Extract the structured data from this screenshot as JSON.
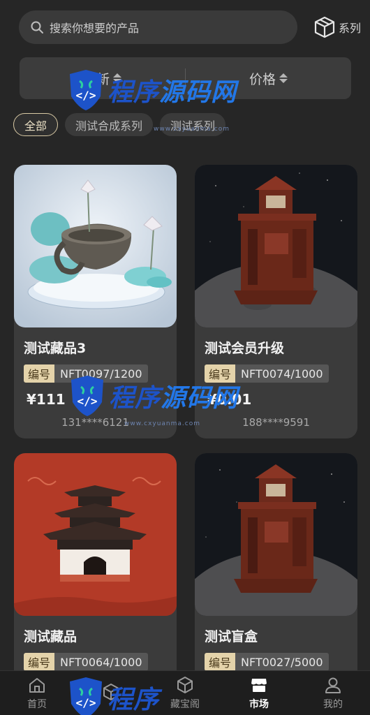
{
  "search": {
    "placeholder": "搜索你想要的产品"
  },
  "series_button": {
    "label": "系列"
  },
  "sort": {
    "newest_label": "最新",
    "price_label": "价格"
  },
  "filters": [
    "全部",
    "测试合成系列",
    "测试系列"
  ],
  "products": [
    {
      "name": "测试藏品3",
      "serial_label": "编号",
      "serial": "NFT0097/1200",
      "price": "¥111",
      "owner": "131****6121",
      "image": "lotus-teacup"
    },
    {
      "name": "测试会员升级",
      "serial_label": "编号",
      "serial": "NFT0074/1000",
      "price": "¥0.01",
      "owner": "188****9591",
      "image": "wooden-tower-on-moon"
    },
    {
      "name": "测试藏品",
      "serial_label": "编号",
      "serial": "NFT0064/1000",
      "price": "",
      "owner": "",
      "image": "chinese-pagoda-red"
    },
    {
      "name": "测试盲盒",
      "serial_label": "编号",
      "serial": "NFT0027/5000",
      "price": "",
      "owner": "",
      "image": "wooden-tower-on-moon"
    }
  ],
  "nav": [
    {
      "label": "首页",
      "icon": "home-icon"
    },
    {
      "label": "",
      "icon": "cube-icon"
    },
    {
      "label": "藏宝阁",
      "icon": "cube-icon"
    },
    {
      "label": "市场",
      "icon": "store-icon"
    },
    {
      "label": "我的",
      "icon": "user-icon"
    }
  ],
  "watermark": {
    "text_a": "程序",
    "text_b": "源码网",
    "sub": "www.cxyuanma.com"
  },
  "colors": {
    "background": "#262626",
    "panel": "#3b3b3b",
    "accent_gold": "#e4d3aa",
    "watermark_blue": "#1d53c9"
  }
}
